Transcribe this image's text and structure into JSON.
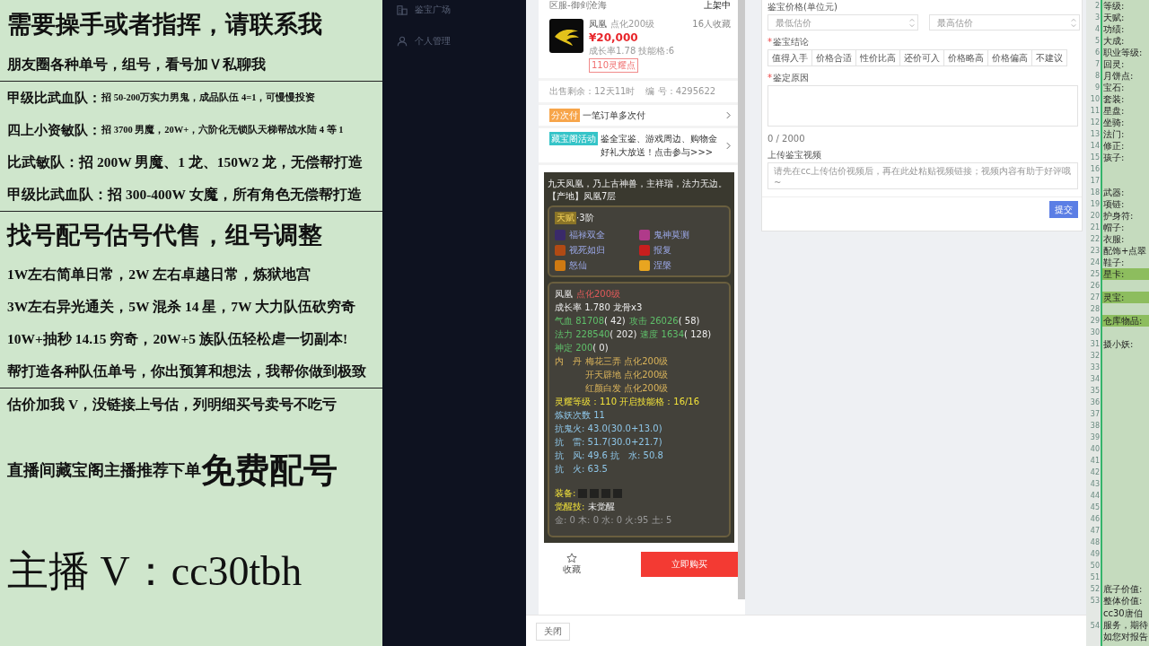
{
  "overlay": {
    "sections": [
      {
        "lines": [
          {
            "kind": "headline",
            "text": "需要操手或者指挥，请联系我"
          },
          {
            "kind": "line",
            "text": "朋友圈各种单号，组号，看号加Ｖ私聊我"
          }
        ]
      },
      {
        "lines": [
          {
            "kind": "offer",
            "lead": "甲级比武血队：",
            "text": "招 50-200万实力男鬼，成品队伍 4=1，可慢慢投资"
          },
          {
            "kind": "offer",
            "lead": "四上小资敏队：",
            "text": "招 3700 男魔，20W+，六阶化无锁队天梯帮战水陆 4 等 1"
          },
          {
            "kind": "line",
            "text": "比武敏队：招 200W 男魔、1 龙、150W2 龙，无偿帮打造"
          },
          {
            "kind": "line",
            "text": "甲级比武血队：招 300-400W 女魔，所有角色无偿帮打造"
          }
        ]
      },
      {
        "lines": [
          {
            "kind": "headline",
            "text": "找号配号估号代售，组号调整"
          },
          {
            "kind": "line",
            "text": "1W左右简单日常，2W 左右卓越日常，炼狱地宫"
          },
          {
            "kind": "line",
            "text": "3W左右异光通关，5W 混杀 14 星，7W 大力队伍砍穷奇"
          },
          {
            "kind": "line",
            "text": "10W+抽秒 14.15 穷奇，20W+5 族队伍轻松虐一切副本!"
          },
          {
            "kind": "line",
            "text": "帮打造各种队伍单号，你出预算和想法，我帮你做到极致"
          }
        ]
      },
      {
        "lines": [
          {
            "kind": "line",
            "text": "估价加我 V，没链接上号估，列明细买号卖号不吃亏"
          },
          {
            "kind": "promo",
            "text": "直播间藏宝阁主播推荐下单",
            "emphasis": "免费配号"
          },
          {
            "kind": "contact",
            "text": "主播 V：cc30tbh"
          }
        ]
      }
    ]
  },
  "sidebar": {
    "items": [
      {
        "label": "鉴宝广场"
      },
      {
        "label": "个人管理"
      }
    ]
  },
  "listing": {
    "server": "区服-御剑沧海",
    "status": "上架中",
    "item": {
      "name": "凤凰",
      "level": "点化200级",
      "favorites": "16人收藏",
      "price": "¥20,000",
      "stats": "成长率1.78 技能格:6",
      "tag": "110灵耀点"
    },
    "sale_time": "出售剩余：12天11时",
    "serial": "编 号：4295622",
    "promos": [
      {
        "tag": "分次付",
        "text": "一笔订单多次付",
        "color": "#f7a54a"
      },
      {
        "tag": "藏宝阁活动",
        "text": "鉴全宝鉴、游戏周边、购物金好礼大放送！点击参与>>>",
        "color": "#35c4c8"
      }
    ],
    "details": {
      "description": "九天凤凰，乃上古神兽，主祥瑞，法力无边。",
      "origin": "【产地】凤凰7层",
      "talent": {
        "badge": "天赋",
        "tier": "·3阶"
      },
      "skills": [
        "福禄双全",
        "鬼神莫测",
        "视死如归",
        "报复",
        "怒仙",
        "涅槃"
      ],
      "stat_lines": [
        {
          "segments": [
            {
              "kind": "white",
              "text": "凤凰"
            },
            {
              "kind": "red",
              "text": "点化200级",
              "gap": true
            }
          ]
        },
        {
          "segments": [
            {
              "kind": "white",
              "text": "成长率 1.780 龙骨x3"
            }
          ]
        },
        {
          "segments": [
            {
              "kind": "green",
              "text": "气血 81708"
            },
            {
              "kind": "white",
              "text": "( 42)"
            },
            {
              "kind": "green",
              "text": "攻击 26026",
              "gap": true
            },
            {
              "kind": "white",
              "text": "( 58)"
            }
          ]
        },
        {
          "segments": [
            {
              "kind": "green",
              "text": "法力 228540"
            },
            {
              "kind": "white",
              "text": "( 202)"
            },
            {
              "kind": "green",
              "text": "速度 1634",
              "gap": true
            },
            {
              "kind": "white",
              "text": "( 128)"
            }
          ]
        },
        {
          "segments": [
            {
              "kind": "green",
              "text": "神定 200"
            },
            {
              "kind": "white",
              "text": "( 0)"
            }
          ]
        },
        {
          "segments": [
            {
              "kind": "gold",
              "text": "内　丹"
            },
            {
              "kind": "gold",
              "text": "梅花三弄 点化200级",
              "gap": true
            }
          ]
        },
        {
          "indent": true,
          "segments": [
            {
              "kind": "gold",
              "text": "开天辟地 点化200级"
            }
          ]
        },
        {
          "indent": true,
          "segments": [
            {
              "kind": "gold",
              "text": "红颜白发 点化200级"
            }
          ]
        },
        {
          "segments": [
            {
              "kind": "yellow",
              "text": "灵耀等级：110 开启技能格：16/16"
            }
          ]
        },
        {
          "segments": [
            {
              "kind": "blue",
              "text": "炼妖次数 11"
            }
          ]
        },
        {
          "segments": [
            {
              "kind": "blue",
              "text": "抗鬼火: 43.0(30.0+13.0)"
            }
          ]
        },
        {
          "segments": [
            {
              "kind": "blue",
              "text": "抗　雷: 51.7(30.0+21.7)"
            }
          ]
        },
        {
          "segments": [
            {
              "kind": "blue",
              "text": "抗　风: 49.6 抗　水: 50.8"
            }
          ]
        },
        {
          "segments": [
            {
              "kind": "blue",
              "text": "抗　火: 63.5"
            }
          ]
        }
      ],
      "equipment_label": "装备:",
      "awakening_label": "觉醒技:",
      "awakening_value": "未觉醒",
      "elements": "金: 0 木: 0 水: 0 火:95 土: 5"
    },
    "actions": {
      "favorite": "收藏",
      "buy": "立即购买"
    }
  },
  "appraisal_form": {
    "price_label": "鉴宝价格(单位元)",
    "min_placeholder": "最低估价",
    "max_placeholder": "最高估价",
    "conclusion_label": {
      "mark": "*",
      "text": "鉴宝结论"
    },
    "options": [
      {
        "label": "值得入手",
        "selected": false
      },
      {
        "label": "价格合适",
        "selected": false
      },
      {
        "label": "性价比高",
        "selected": false
      },
      {
        "label": "还价可入",
        "selected": false
      },
      {
        "label": "价格略高",
        "selected": false
      },
      {
        "label": "价格偏高",
        "selected": false
      },
      {
        "label": "不建议",
        "selected": false
      }
    ],
    "reason_label": {
      "mark": "*",
      "text": "鉴定原因"
    },
    "counter": "0 / 2000",
    "video_label": "上传鉴宝视频",
    "video_placeholder": "请先在cc上传估价视频后，再在此处粘贴视频链接；视频内容有助于好评哦~",
    "submit": "提交"
  },
  "footer": {
    "close_button": "关闭"
  },
  "sheet": {
    "rows": [
      {
        "number": "2",
        "label": "等级:",
        "highlighted": false
      },
      {
        "number": "3",
        "label": "天赋:",
        "highlighted": false
      },
      {
        "number": "4",
        "label": "功绩:",
        "highlighted": false
      },
      {
        "number": "5",
        "label": "大成:",
        "highlighted": false
      },
      {
        "number": "6",
        "label": "职业等级:",
        "highlighted": false
      },
      {
        "number": "7",
        "label": "回灵:",
        "highlighted": false
      },
      {
        "number": "8",
        "label": "月饼点:",
        "highlighted": false
      },
      {
        "number": "9",
        "label": "宝石:",
        "highlighted": false
      },
      {
        "number": "10",
        "label": "套装:",
        "highlighted": false
      },
      {
        "number": "11",
        "label": "星盘:",
        "highlighted": false
      },
      {
        "number": "12",
        "label": "坐骑:",
        "highlighted": false
      },
      {
        "number": "13",
        "label": "法门:",
        "highlighted": false
      },
      {
        "number": "14",
        "label": "修正:",
        "highlighted": false
      },
      {
        "number": "15",
        "label": "孩子:",
        "highlighted": false
      },
      {
        "number": "16",
        "highlighted": false
      },
      {
        "number": "17",
        "highlighted": false
      },
      {
        "number": "18",
        "label": "武器:",
        "highlighted": false
      },
      {
        "number": "19",
        "label": "项链:",
        "highlighted": false
      },
      {
        "number": "20",
        "label": "护身符:",
        "highlighted": false
      },
      {
        "number": "21",
        "label": "帽子:",
        "highlighted": false
      },
      {
        "number": "22",
        "label": "衣服:",
        "highlighted": false
      },
      {
        "number": "23",
        "label": "配饰+点翠",
        "highlighted": false
      },
      {
        "number": "24",
        "label": "鞋子:",
        "highlighted": false
      },
      {
        "number": "25",
        "label": "星卡:",
        "highlighted": true
      },
      {
        "number": "26",
        "highlighted": false
      },
      {
        "number": "27",
        "label": "灵宝:",
        "highlighted": true
      },
      {
        "number": "28",
        "highlighted": false
      },
      {
        "number": "29",
        "label": "仓库物品:",
        "highlighted": true
      },
      {
        "number": "30",
        "highlighted": false
      },
      {
        "number": "31",
        "label": "摄小妖:",
        "highlighted": false
      },
      {
        "number": "32",
        "highlighted": false
      },
      {
        "number": "33",
        "highlighted": false
      },
      {
        "number": "34",
        "highlighted": false
      },
      {
        "number": "35",
        "highlighted": false
      },
      {
        "number": "36",
        "highlighted": false
      },
      {
        "number": "37",
        "highlighted": false
      },
      {
        "number": "38",
        "highlighted": false
      },
      {
        "number": "39",
        "highlighted": false
      },
      {
        "number": "40",
        "highlighted": false
      },
      {
        "number": "41",
        "highlighted": false
      },
      {
        "number": "42",
        "highlighted": false
      },
      {
        "number": "43",
        "highlighted": false
      },
      {
        "number": "44",
        "highlighted": false
      },
      {
        "number": "45",
        "highlighted": false
      },
      {
        "number": "46",
        "highlighted": false
      },
      {
        "number": "47",
        "highlighted": false
      },
      {
        "number": "48",
        "highlighted": false
      },
      {
        "number": "49",
        "highlighted": false
      },
      {
        "number": "50",
        "highlighted": false
      },
      {
        "number": "51",
        "highlighted": false
      },
      {
        "number": "52",
        "label": "底子价值:",
        "highlighted": false
      },
      {
        "number": "53",
        "label": "整体价值:",
        "highlighted": false
      },
      {
        "number": "54",
        "lines": [
          "cc30唐伯",
          "服务，期待",
          "如您对报告"
        ],
        "highlighted": false
      }
    ]
  }
}
